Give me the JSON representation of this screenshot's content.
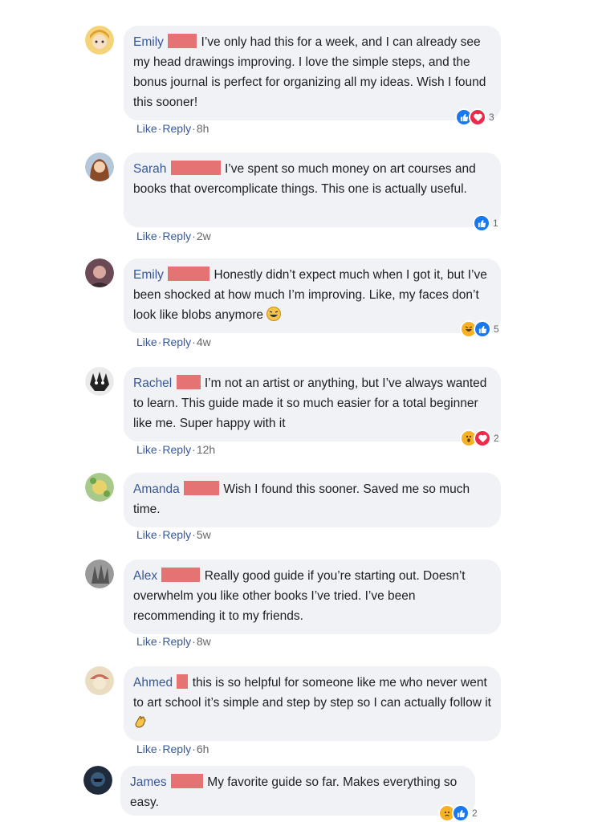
{
  "comments": [
    {
      "author": "Emily",
      "text": "I’ve only had this for a week, and I can already see my head drawings improving. I love the simple steps, and the bonus journal is perfect for organizing all my ideas. Wish I found this sooner!",
      "time": "8h",
      "reaction_count": "3",
      "reactions": [
        "like-icon",
        "love-icon"
      ]
    },
    {
      "author": "Sarah",
      "text": "I’ve spent so much money on art courses and books that overcomplicate things. This one is actually useful.",
      "time": "2w",
      "reaction_count": "1",
      "reactions": [
        "like-icon"
      ]
    },
    {
      "author": "Emily",
      "text": "Honestly didn’t expect much when I got it, but I’ve been shocked at how much I’m improving. Like, my faces don’t look like blobs anymore",
      "time": "4w",
      "reaction_count": "5",
      "reactions": [
        "haha-icon",
        "like-icon"
      ]
    },
    {
      "author": "Rachel",
      "text": "I’m not an artist or anything, but I’ve always wanted to learn. This guide made it so much easier for a total beginner like me. Super happy with it",
      "time": "12h",
      "reaction_count": "2",
      "reactions": [
        "wow-icon",
        "love-icon"
      ]
    },
    {
      "author": "Amanda",
      "text": "Wish I found this sooner. Saved me so much time.",
      "time": "5w"
    },
    {
      "author": "Alex",
      "text": "Really good guide if you’re starting out. Doesn’t overwhelm you like other books I’ve tried. I’ve been recommending it to my friends.",
      "time": "8w"
    },
    {
      "author": "Ahmed",
      "text": "this is so helpful for someone like me who never went to art school it’s simple and step by step so I can actually follow it",
      "time": "6h"
    },
    {
      "author": "James",
      "text": "My favorite guide so far. Makes everything so easy.",
      "reaction_count": "2",
      "reactions": [
        "sad-icon",
        "like-icon"
      ]
    }
  ],
  "actions": {
    "like": "Like",
    "reply": "Reply",
    "dot": "·"
  },
  "colors": {
    "link": "#385898",
    "bubble": "#f0f2f5",
    "redaction": "#e57373",
    "like": "#1877f2",
    "love": "#f02849"
  }
}
